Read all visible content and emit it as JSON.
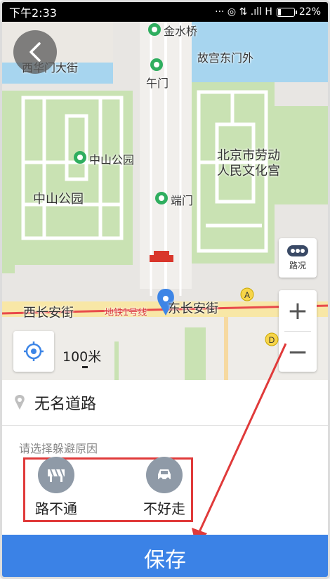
{
  "status_bar": {
    "time": "下午2:33",
    "indicators": "··· ◎ ⇅ .ıll H",
    "network": "H",
    "battery": "22%",
    "battery_fraction": 0.22
  },
  "map": {
    "labels": {
      "jinshuiqiao": "金水桥",
      "xihuamen": "西华门大街",
      "gugong_dongmen": "故宫东门外",
      "wumen": "午门",
      "zhongshan_park_poi": "中山公园",
      "zhongshan_park": "中山公园",
      "laodong_1": "北京市劳动",
      "laodong_2": "人民文化宫",
      "duanmen": "端门",
      "xichangan": "西长安街",
      "dongchangan": "东长安街",
      "subway": "地铁1号线"
    },
    "traffic_label": "路况",
    "zoom_in": "+",
    "zoom_out": "−",
    "scale": "100米",
    "station_a": "A",
    "station_d": "D"
  },
  "panel": {
    "road_name": "无名道路",
    "reason_title": "请选择躲避原因",
    "reasons": [
      {
        "label": "路不通",
        "icon": "roadblock-icon"
      },
      {
        "label": "不好走",
        "icon": "car-icon"
      }
    ],
    "save_label": "保存"
  },
  "colors": {
    "accent": "#3b82e6",
    "highlight_red": "#e03a3a",
    "park_green": "#c9e2b3",
    "water": "#a7d5ef",
    "poi_green": "#2fae5f",
    "pin_blue": "#3d85e6"
  }
}
